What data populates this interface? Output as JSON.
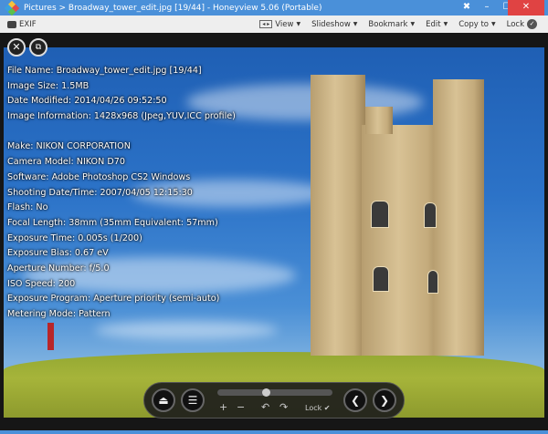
{
  "titlebar": {
    "title": "Pictures > Broadway_tower_edit.jpg [19/44] - Honeyview 5.06 (Portable)",
    "pin": "✖",
    "minimize": "–",
    "maximize": "☐",
    "close": "✕"
  },
  "toolbar": {
    "exif": "EXIF",
    "view": "View",
    "slideshow": "Slideshow",
    "bookmark": "Bookmark",
    "edit": "Edit",
    "copy_to": "Copy to",
    "lock": "Lock"
  },
  "info": {
    "lines": [
      "File Name: Broadway_tower_edit.jpg [19/44]",
      "Image Size: 1.5MB",
      "Date Modified: 2014/04/26 09:52:50",
      "Image Information: 1428x968 (Jpeg,YUV,ICC profile)",
      "",
      "Make: NIKON CORPORATION",
      "Camera Model: NIKON D70",
      "Software: Adobe Photoshop CS2 Windows",
      "Shooting Date/Time: 2007/04/05 12:15:30",
      "Flash: No",
      "Focal Length: 38mm (35mm Equivalent: 57mm)",
      "Exposure Time: 0.005s (1/200)",
      "Exposure Bias: 0.67 eV",
      "Aperture Number: f/5.0",
      "ISO Speed: 200",
      "Exposure Program: Aperture priority (semi-auto)",
      "Metering Mode: Pattern"
    ]
  },
  "controls": {
    "lock": "Lock",
    "slider_position": 0.42,
    "zoom_in": "+",
    "zoom_out": "−",
    "rotate_left": "↶",
    "rotate_right": "↷"
  }
}
